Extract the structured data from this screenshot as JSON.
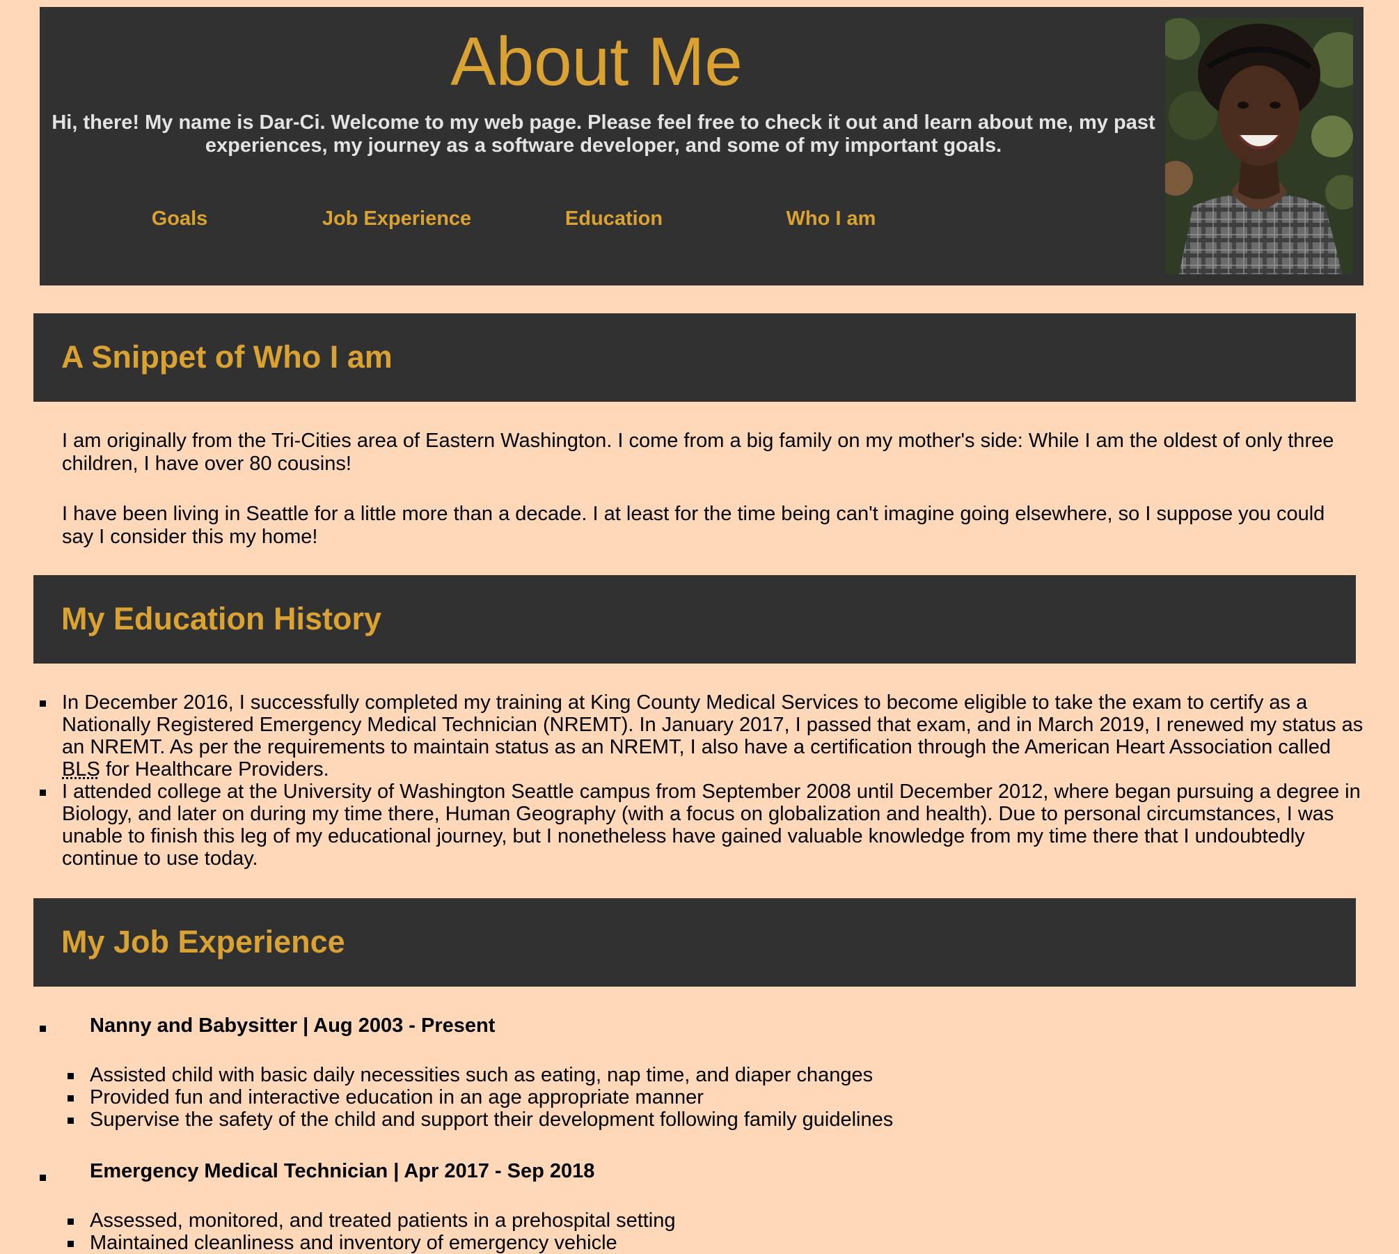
{
  "header": {
    "title": "About Me",
    "intro": "Hi, there! My name is Dar-Ci. Welcome to my web page. Please feel free to check it out and learn about me, my past experiences, my journey as a software developer, and some of my important goals.",
    "nav": [
      "Goals",
      "Job Experience",
      "Education",
      "Who I am"
    ]
  },
  "who": {
    "heading": "A Snippet of Who I am",
    "paragraphs": [
      "I am originally from the Tri-Cities area of Eastern Washington. I come from a big family on my mother's side: While I am the oldest of only three children, I have over 80 cousins!",
      "I have been living in Seattle for a little more than a decade. I at least for the time being can't imagine going elsewhere, so I suppose you could say I consider this my home!"
    ]
  },
  "education": {
    "heading": "My Education History",
    "item1_before": "In December 2016, I successfully completed my training at King County Medical Services to become eligible to take the exam to certify as a Nationally Registered Emergency Medical Technician (NREMT). In January 2017, I passed that exam, and in March 2019, I renewed my status as an NREMT. As per the requirements to maintain status as an NREMT, I also have a certification through the American Heart Association called ",
    "item1_abbr": "BLS",
    "item1_after": " for Healthcare Providers.",
    "item2": "I attended college at the University of Washington Seattle campus from September 2008 until December 2012, where began pursuing a degree in Biology, and later on during my time there, Human Geography (with a focus on globalization and health). Due to personal circumstances, I was unable to finish this leg of my educational journey, but I nonetheless have gained valuable knowledge from my time there that I undoubtedly continue to use today."
  },
  "jobs": {
    "heading": "My Job Experience",
    "list": [
      {
        "title": "Nanny and Babysitter | Aug 2003 - Present",
        "duties": [
          "Assisted child with basic daily necessities such as eating, nap time, and diaper changes",
          "Provided fun and interactive education in an age appropriate manner",
          "Supervise the safety of the child and support their development following family guidelines"
        ]
      },
      {
        "title": "Emergency Medical Technician | Apr 2017 - Sep 2018",
        "duties": [
          "Assessed, monitored, and treated patients in a prehospital setting",
          "Maintained cleanliness and inventory of emergency vehicle"
        ]
      }
    ]
  }
}
